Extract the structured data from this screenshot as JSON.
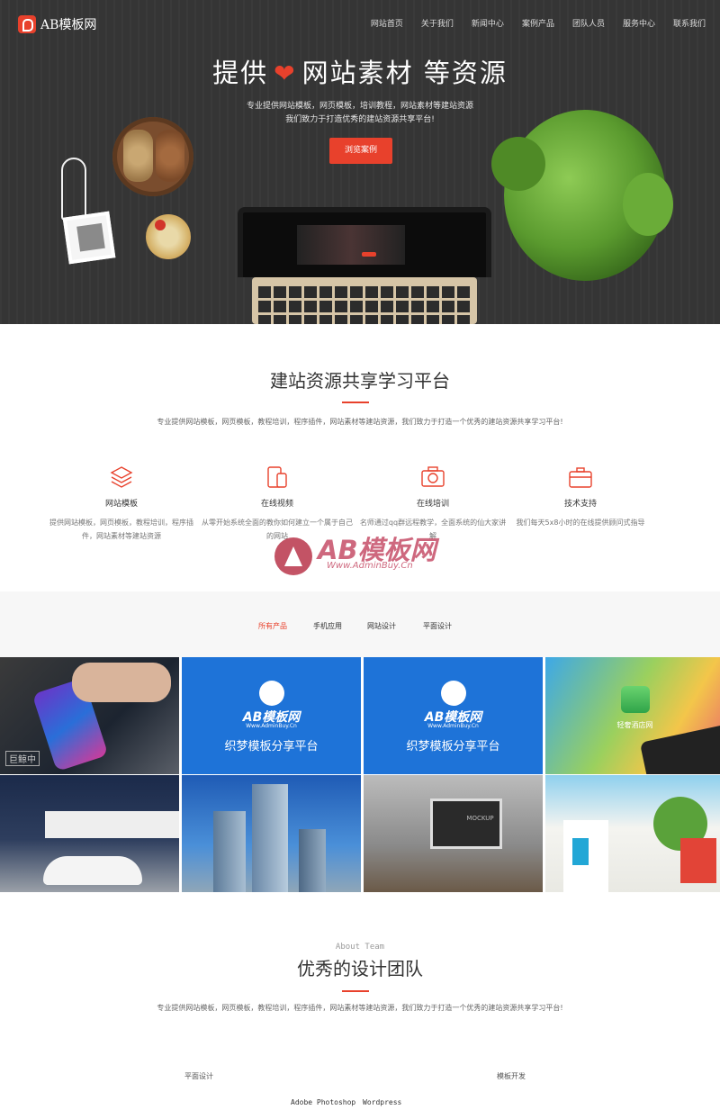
{
  "nav": {
    "logo_text": "AB模板网",
    "items": [
      "网站首页",
      "关于我们",
      "新闻中心",
      "案例产品",
      "团队人员",
      "服务中心",
      "联系我们"
    ]
  },
  "hero": {
    "title_left": "提供",
    "title_right": "网站素材  等资源",
    "line1": "专业提供网站模板，网页模板，培训教程，网站素材等建站资源",
    "line2": "我们致力于打造优秀的建站资源共享平台!",
    "button_label": "浏览案例"
  },
  "platform": {
    "title": "建站资源共享学习平台",
    "desc": "专业提供网站模板，网页模板，教程培训，程序插件，网站素材等建站资源，我们致力于打造一个优秀的建站资源共享学习平台!",
    "features": [
      {
        "icon": "layers-icon",
        "title": "网站模板",
        "desc": "提供网站模板，网页模板，教程培训，程序插件，网站素材等建站资源"
      },
      {
        "icon": "tablet-icon",
        "title": "在线视频",
        "desc": "从零开始系统全面的教你如何建立一个属于自己的网站"
      },
      {
        "icon": "camera-icon",
        "title": "在线培训",
        "desc": "名师通过qq群远程教学，全面系统的仙大家讲解"
      },
      {
        "icon": "briefcase-icon",
        "title": "技术支持",
        "desc": "我们每天5x8小时的在线提供顾问式指导"
      }
    ]
  },
  "watermark": {
    "text": "AB模板网",
    "sub": "Www.AdminBuy.Cn"
  },
  "products": {
    "tabs": [
      "所有产品",
      "手机应用",
      "网站设计",
      "平面设计"
    ],
    "active_tab": 0,
    "tiles": [
      {
        "caption": "",
        "badge": "巨鲸中"
      },
      {
        "caption": "织梦模板分享平台",
        "logo": "AB模板网",
        "logo_sub": "Www.AdminBuy.Cn"
      },
      {
        "caption": "织梦模板分享平台",
        "logo": "AB模板网",
        "logo_sub": "Www.AdminBuy.Cn"
      },
      {
        "caption": "",
        "badge": "轻奢酒店网"
      },
      {
        "caption": ""
      },
      {
        "caption": ""
      },
      {
        "caption": "",
        "badge": "MOCKUP"
      },
      {
        "caption": ""
      }
    ]
  },
  "team": {
    "title_en": "About Team",
    "title": "优秀的设计团队",
    "desc": "专业提供网站模板，网页模板，教程培训，程序插件，网站素材等建站资源，我们致力于打造一个优秀的建站资源共享学习平台!",
    "categories": [
      "平面设计",
      "模板开发"
    ],
    "skills": [
      "Adobe Photoshop",
      "Wordpress"
    ]
  },
  "colors": {
    "accent": "#e8412c",
    "hero_bg": "#353535",
    "tile_blue": "#1e73d8"
  }
}
